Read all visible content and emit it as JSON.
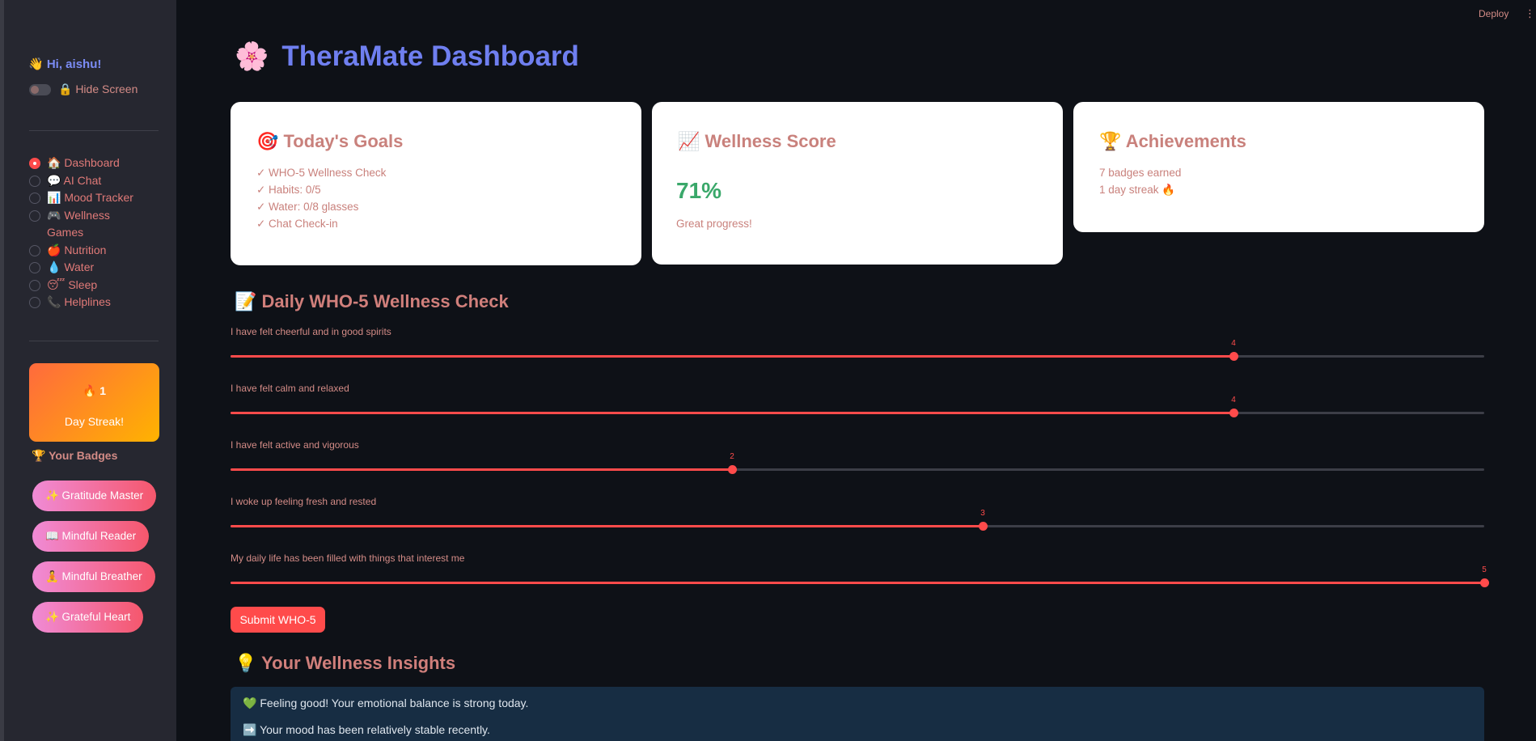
{
  "sidebar": {
    "greeting": "👋 Hi, aishu!",
    "hide_screen_label": "🔒 Hide Screen",
    "nav_items": [
      {
        "label": "🏠 Dashboard",
        "selected": true
      },
      {
        "label": "💬 AI Chat",
        "selected": false
      },
      {
        "label": "📊 Mood Tracker",
        "selected": false
      },
      {
        "label": "🎮 Wellness Games",
        "selected": false
      },
      {
        "label": "🍎 Nutrition",
        "selected": false
      },
      {
        "label": "💧 Water",
        "selected": false
      },
      {
        "label": "😴 Sleep",
        "selected": false
      },
      {
        "label": "📞 Helplines",
        "selected": false
      }
    ],
    "streak": {
      "count": "🔥 1",
      "label": "Day Streak!"
    },
    "badges_title": "🏆 Your Badges",
    "badges": [
      "✨ Gratitude Master",
      "📖 Mindful Reader",
      "🧘 Mindful Breather",
      "✨ Grateful Heart"
    ]
  },
  "header": {
    "deploy_label": "Deploy",
    "menu_icon": "⋮"
  },
  "main": {
    "title_emoji": "🌸",
    "title": "TheraMate Dashboard",
    "cards": {
      "goals": {
        "title": "🎯 Today's Goals",
        "items": [
          "✓ WHO-5 Wellness Check",
          "✓ Habits: 0/5",
          "✓ Water: 0/8 glasses",
          "✓ Chat Check-in"
        ]
      },
      "wellness": {
        "title": "📈 Wellness Score",
        "score": "71%",
        "caption": "Great progress!"
      },
      "achievements": {
        "title": "🏆 Achievements",
        "items": [
          "7 badges earned",
          "1 day streak 🔥"
        ]
      }
    },
    "who5": {
      "title": "📝 Daily WHO-5 Wellness Check",
      "max": 5,
      "questions": [
        {
          "label": "I have felt cheerful and in good spirits",
          "value": 4
        },
        {
          "label": "I have felt calm and relaxed",
          "value": 4
        },
        {
          "label": "I have felt active and vigorous",
          "value": 2
        },
        {
          "label": "I woke up feeling fresh and rested",
          "value": 3
        },
        {
          "label": "My daily life has been filled with things that interest me",
          "value": 5
        }
      ],
      "submit_label": "Submit WHO-5"
    },
    "insights": {
      "title": "💡 Your Wellness Insights",
      "items": [
        "💚 Feeling good! Your emotional balance is strong today.",
        "➡️ Your mood has been relatively stable recently."
      ]
    }
  },
  "colors": {
    "accent": "#ff4b4b",
    "title_blue": "#6f7ff0",
    "score_green": "#3aa86a",
    "background": "#0e1117",
    "sidebar": "#262730"
  }
}
